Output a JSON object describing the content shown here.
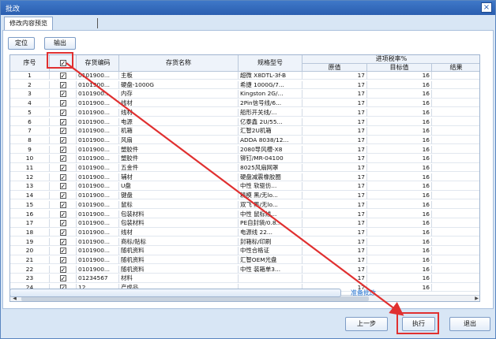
{
  "window": {
    "title": "批改",
    "close_glyph": "×"
  },
  "tab": {
    "label": "修改内容预览"
  },
  "toolbar": {
    "locate_label": "定位",
    "export_label": "输出"
  },
  "grid": {
    "headers": {
      "seq": "序号",
      "code": "存货编码",
      "name": "存货名称",
      "spec": "规格型号",
      "tax_group": "进项税率%",
      "original": "原值",
      "target": "目标值",
      "result": "结果"
    },
    "rows": [
      {
        "seq": "1",
        "checked": true,
        "code": "0101900...",
        "name": "主板",
        "spec": "超微 X8DTL-3f-B",
        "original": "17",
        "target": "16"
      },
      {
        "seq": "2",
        "checked": true,
        "code": "0101900...",
        "name": "硬盘-1000G",
        "spec": "希捷 1000G/7...",
        "original": "17",
        "target": "16"
      },
      {
        "seq": "3",
        "checked": true,
        "code": "0101900...",
        "name": "内存",
        "spec": "Kingston 2G/...",
        "original": "17",
        "target": "16"
      },
      {
        "seq": "4",
        "checked": true,
        "code": "0101900...",
        "name": "线材",
        "spec": "2Pin信号线/6...",
        "original": "17",
        "target": "16"
      },
      {
        "seq": "5",
        "checked": true,
        "code": "0101900...",
        "name": "线材",
        "spec": "船形开关线/...",
        "original": "17",
        "target": "16"
      },
      {
        "seq": "6",
        "checked": true,
        "code": "0101900...",
        "name": "电源",
        "spec": "亿泰鑫 2U/55...",
        "original": "17",
        "target": "16"
      },
      {
        "seq": "7",
        "checked": true,
        "code": "0101900...",
        "name": "机箱",
        "spec": "汇智2U机箱",
        "original": "17",
        "target": "16"
      },
      {
        "seq": "8",
        "checked": true,
        "code": "0101900...",
        "name": "风扇",
        "spec": "ADDA 8038/12...",
        "original": "17",
        "target": "16"
      },
      {
        "seq": "9",
        "checked": true,
        "code": "0101900...",
        "name": "塑胶件",
        "spec": "2080导风槽-X8",
        "original": "17",
        "target": "16"
      },
      {
        "seq": "10",
        "checked": true,
        "code": "0101900...",
        "name": "塑胶件",
        "spec": "铆钉/MR-04100",
        "original": "17",
        "target": "16"
      },
      {
        "seq": "11",
        "checked": true,
        "code": "0101900...",
        "name": "五金件",
        "spec": "8025风扇网罩",
        "original": "17",
        "target": "16"
      },
      {
        "seq": "12",
        "checked": true,
        "code": "0101900...",
        "name": "辅材",
        "spec": "硬盘减震橡胶圈",
        "original": "17",
        "target": "16"
      },
      {
        "seq": "13",
        "checked": true,
        "code": "0101900...",
        "name": "U盘",
        "spec": "中性 软驱仿...",
        "original": "17",
        "target": "16"
      },
      {
        "seq": "14",
        "checked": true,
        "code": "0101900...",
        "name": "键盘",
        "spec": "精模 黑/无lo...",
        "original": "17",
        "target": "16"
      },
      {
        "seq": "15",
        "checked": true,
        "code": "0101900...",
        "name": "鼠标",
        "spec": "双飞 黑/无lo...",
        "original": "17",
        "target": "16"
      },
      {
        "seq": "16",
        "checked": true,
        "code": "0101900...",
        "name": "包装材料",
        "spec": "中性 鼠标线...",
        "original": "17",
        "target": "16"
      },
      {
        "seq": "17",
        "checked": true,
        "code": "0101900...",
        "name": "包装材料",
        "spec": "PE自封袋/0.8...",
        "original": "17",
        "target": "16"
      },
      {
        "seq": "18",
        "checked": true,
        "code": "0101900...",
        "name": "线材",
        "spec": "电源线 22...",
        "original": "17",
        "target": "16"
      },
      {
        "seq": "19",
        "checked": true,
        "code": "0101900...",
        "name": "商标/贴标",
        "spec": "封箱标/印刷",
        "original": "17",
        "target": "16"
      },
      {
        "seq": "20",
        "checked": true,
        "code": "0101900...",
        "name": "随机资料",
        "spec": "中性合格证",
        "original": "17",
        "target": "16"
      },
      {
        "seq": "21",
        "checked": true,
        "code": "0101900...",
        "name": "随机资料",
        "spec": "汇智OEM光盘",
        "original": "17",
        "target": "16"
      },
      {
        "seq": "22",
        "checked": true,
        "code": "0101900...",
        "name": "随机资料",
        "spec": "中性 装箱单3...",
        "original": "17",
        "target": "16"
      },
      {
        "seq": "23",
        "checked": true,
        "code": "01234567",
        "name": "材料",
        "spec": "",
        "original": "17",
        "target": "16"
      },
      {
        "seq": "24",
        "checked": true,
        "code": "12",
        "name": "产成品",
        "spec": "",
        "original": "17",
        "target": "16"
      }
    ]
  },
  "progress": {
    "fraction": 0
  },
  "status_text": "准备批改",
  "footer": {
    "prev_label": "上一步",
    "execute_label": "执行",
    "exit_label": "退出"
  },
  "colors": {
    "highlight": "#e03030",
    "status": "#1c6fd0",
    "title_bar": "#2a5eb0"
  },
  "icons": {
    "close": "close-icon",
    "checkbox": "checkbox-icon"
  }
}
